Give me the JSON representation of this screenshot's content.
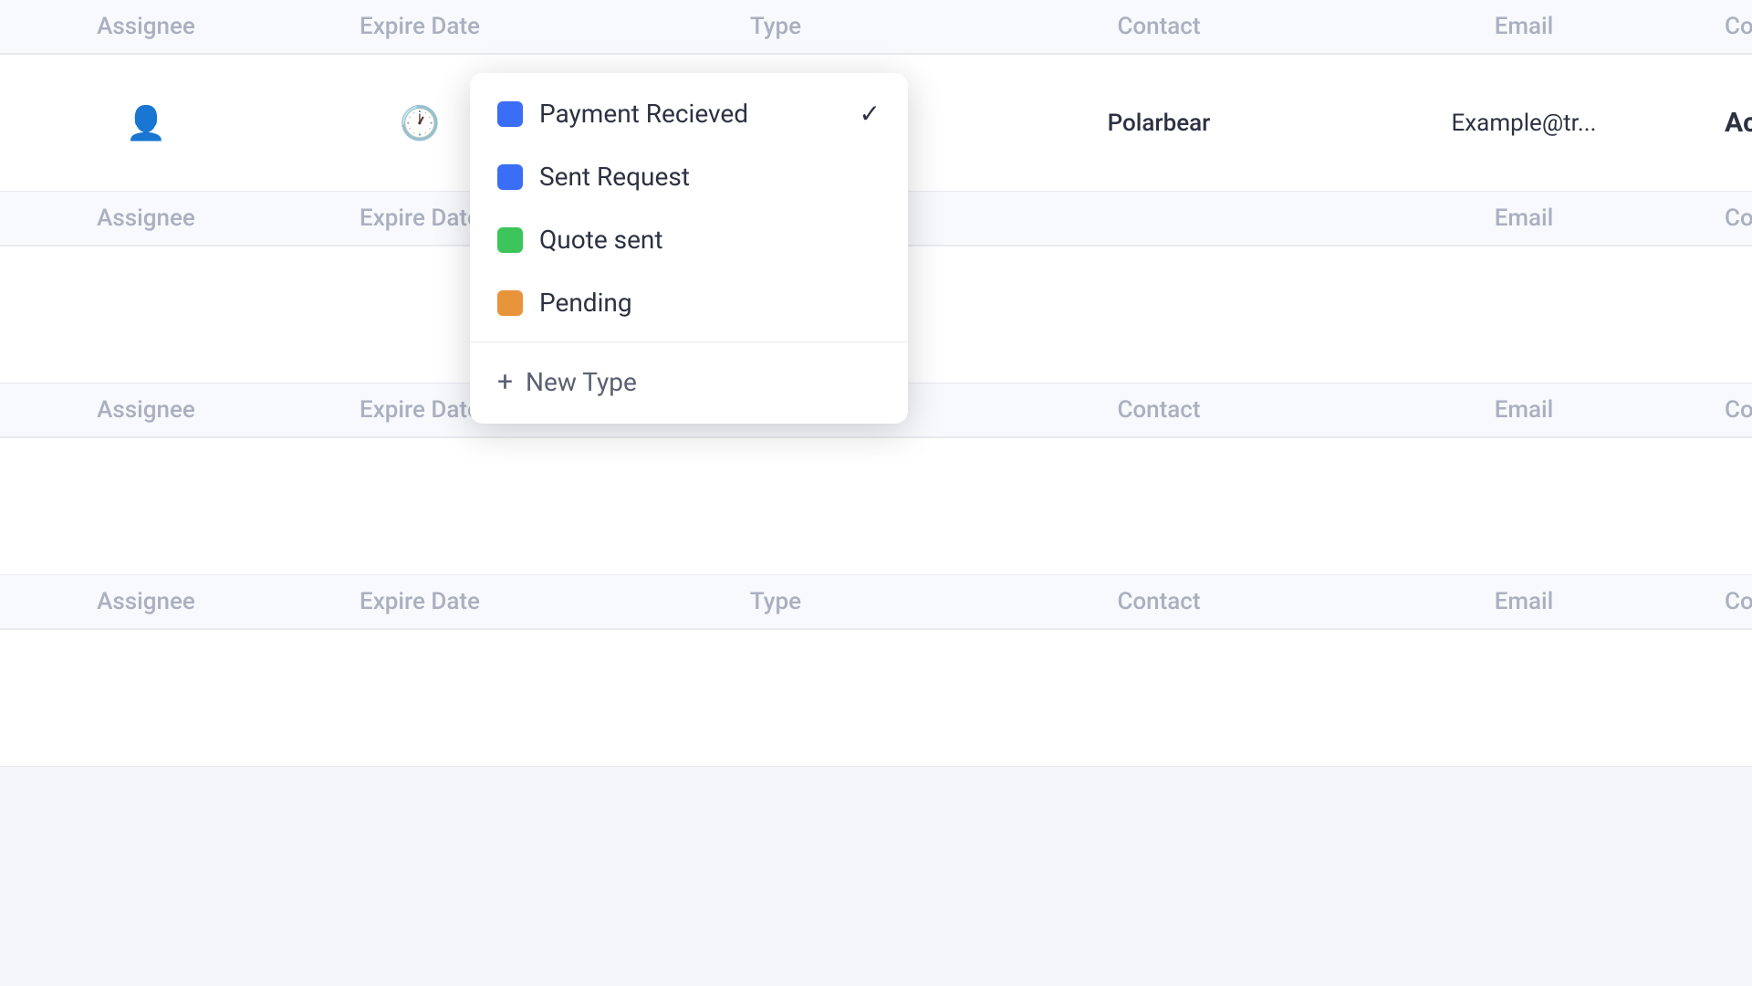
{
  "columns": {
    "assignee": "Assignee",
    "expire_date": "Expire Date",
    "type": "Type",
    "contact": "Contact",
    "email": "Email",
    "commitment": "Commitment"
  },
  "rows": [
    {
      "id": "header1",
      "is_header": true
    },
    {
      "id": "row1",
      "is_header": false,
      "has_data": true,
      "type_value": "Payment Re...",
      "contact_value": "Polarbear",
      "email_value": "Example@tr...",
      "commitment_value": "Active"
    },
    {
      "id": "header2",
      "is_header": true
    },
    {
      "id": "row2",
      "is_header": false,
      "has_data": false
    },
    {
      "id": "header3",
      "is_header": true
    },
    {
      "id": "row3",
      "is_header": false,
      "has_data": false
    },
    {
      "id": "header4",
      "is_header": true
    },
    {
      "id": "row4",
      "is_header": false,
      "has_data": false
    }
  ],
  "dropdown": {
    "items": [
      {
        "label": "Payment Recieved",
        "color": "#3b6ef6",
        "selected": true
      },
      {
        "label": "Sent Request",
        "color": "#3b6ef6",
        "selected": false
      },
      {
        "label": "Quote sent",
        "color": "#3dc45a",
        "selected": false
      },
      {
        "label": "Pending",
        "color": "#e8943a",
        "selected": false
      }
    ],
    "new_type_label": "+ New Type"
  }
}
